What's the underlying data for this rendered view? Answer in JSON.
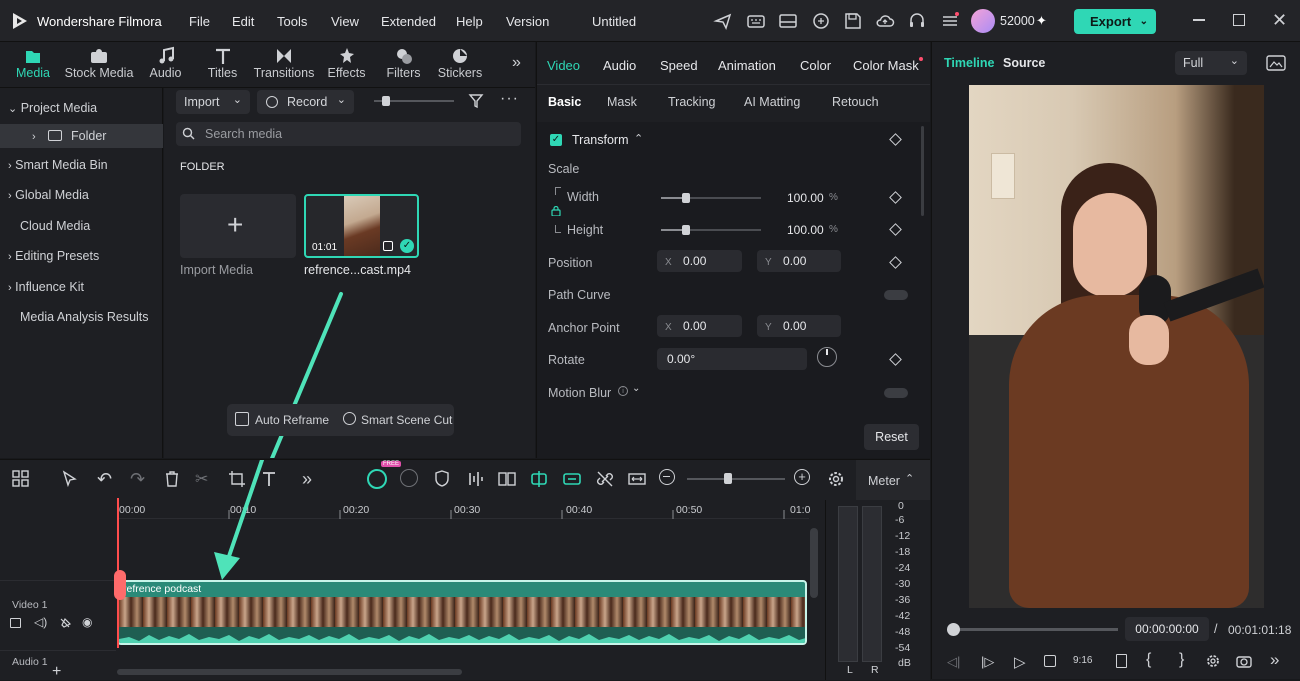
{
  "app": {
    "name": "Wondershare Filmora",
    "project_title": "Untitled",
    "credits": "52000",
    "export_label": "Export"
  },
  "menu": [
    "File",
    "Edit",
    "Tools",
    "View",
    "Extended",
    "Help",
    "Version"
  ],
  "media_tabs": [
    {
      "label": "Media",
      "icon": "media-icon",
      "active": true
    },
    {
      "label": "Stock Media",
      "icon": "stock-media-icon"
    },
    {
      "label": "Audio",
      "icon": "music-note-icon"
    },
    {
      "label": "Titles",
      "icon": "text-t-icon"
    },
    {
      "label": "Transitions",
      "icon": "transitions-icon"
    },
    {
      "label": "Effects",
      "icon": "effects-icon"
    },
    {
      "label": "Filters",
      "icon": "filters-icon"
    },
    {
      "label": "Stickers",
      "icon": "stickers-icon"
    }
  ],
  "sidebar": {
    "project_media": "Project Media",
    "folder": "Folder",
    "items": [
      "Smart Media Bin",
      "Global Media",
      "Cloud Media",
      "Editing Presets",
      "Influence Kit",
      "Media Analysis Results"
    ]
  },
  "media": {
    "import_label": "Import",
    "record_label": "Record",
    "search_placeholder": "Search media",
    "folder_header": "FOLDER",
    "import_media_label": "Import Media",
    "clip_name": "refrence...cast.mp4",
    "clip_duration": "01:01",
    "auto_reframe": "Auto Reframe",
    "smart_scene_cut": "Smart Scene Cut"
  },
  "props": {
    "tabs": [
      "Video",
      "Audio",
      "Speed",
      "Animation",
      "Color",
      "Color Mask"
    ],
    "subtabs": [
      "Basic",
      "Mask",
      "Tracking",
      "AI Matting",
      "Retouch"
    ],
    "transform": "Transform",
    "scale": "Scale",
    "width": "Width",
    "height": "Height",
    "width_value": "100.00",
    "height_value": "100.00",
    "percent": "%",
    "position": "Position",
    "pos_x": "0.00",
    "pos_y": "0.00",
    "x": "X",
    "y": "Y",
    "path_curve": "Path Curve",
    "anchor_point": "Anchor Point",
    "anchor_x": "0.00",
    "anchor_y": "0.00",
    "rotate": "Rotate",
    "rotate_value": "0.00°",
    "motion_blur": "Motion Blur",
    "reset": "Reset",
    "width_fraction": 0.25,
    "height_fraction": 0.25
  },
  "preview": {
    "tab_timeline": "Timeline",
    "tab_source": "Source",
    "quality": "Full",
    "current_time": "00:00:00:00",
    "separator": "/",
    "total_time": "00:01:01:18"
  },
  "timeline": {
    "ticks": [
      "00:00",
      "00:10",
      "00:20",
      "00:30",
      "00:40",
      "00:50",
      "01:0"
    ],
    "meter_label": "Meter",
    "free_badge": "FREE",
    "meter_scale": [
      "0",
      "-6",
      "-12",
      "-18",
      "-24",
      "-30",
      "-36",
      "-42",
      "-48",
      "-54",
      "dB"
    ],
    "meter_l": "L",
    "meter_r": "R",
    "video_track": "Video 1",
    "audio_track": "Audio 1",
    "clip_label": "refrence podcast"
  },
  "colors": {
    "accent": "#2fd7b5",
    "export_bg": "#2fd7b5",
    "playhead": "#ff4d4d",
    "clip_bg": "#2a8a78"
  }
}
